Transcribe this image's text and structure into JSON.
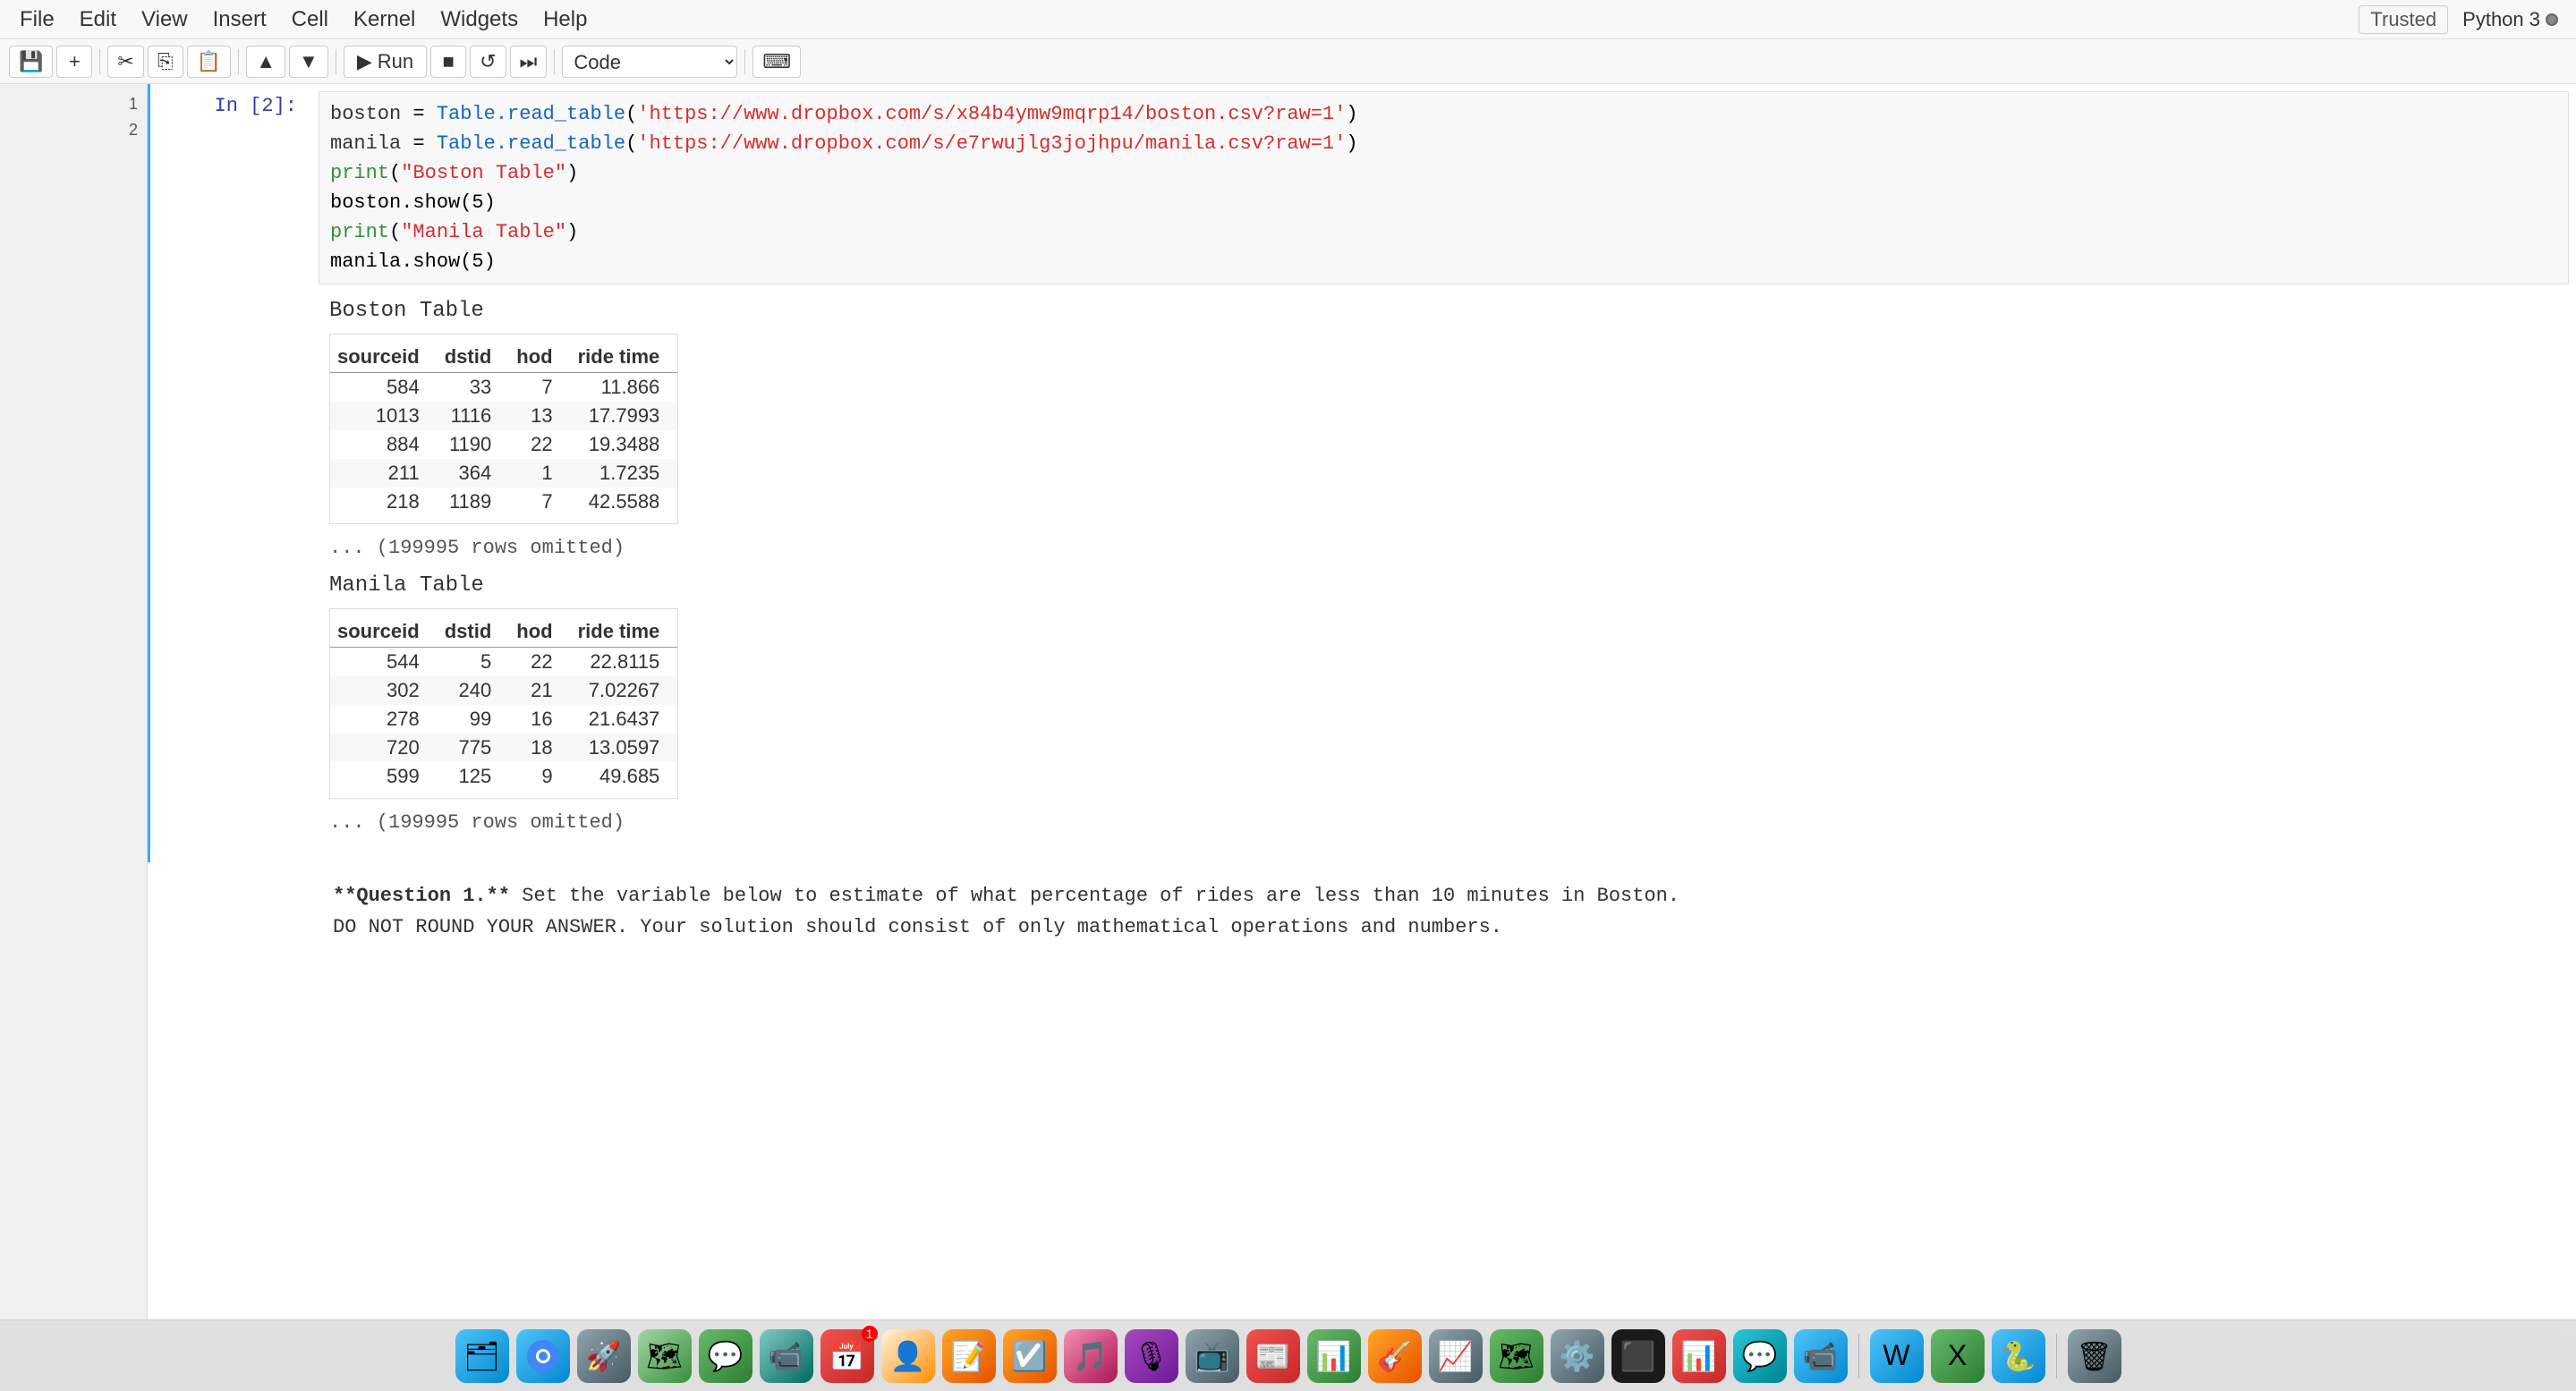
{
  "menubar": {
    "items": [
      "File",
      "Edit",
      "View",
      "Insert",
      "Cell",
      "Kernel",
      "Widgets",
      "Help"
    ],
    "trusted": "Trusted",
    "kernel_name": "Python 3"
  },
  "toolbar": {
    "save_label": "💾",
    "add_label": "+",
    "cut_label": "✂",
    "copy_label": "⎘",
    "paste_label": "📋",
    "move_up_label": "▲",
    "move_down_label": "▼",
    "run_label": "Run",
    "stop_label": "■",
    "restart_label": "↺",
    "skip_label": "⏭",
    "cell_type": "Code",
    "keyboard_label": "⌨"
  },
  "cell": {
    "prompt": "In [2]:",
    "code_lines": [
      "boston = Table.read_table('https://www.dropbox.com/s/x84b4ymw9mqrp14/boston.csv?raw=1')",
      "manila = Table.read_table('https://www.dropbox.com/s/e7rwujlg3jojhpu/manila.csv?raw=1')",
      "print(\"Boston Table\")",
      "boston.show(5)",
      "print(\"Manila Table\")",
      "manila.show(5)"
    ]
  },
  "output": {
    "boston_title": "Boston Table",
    "boston_table": {
      "headers": [
        "sourceid",
        "dstid",
        "hod",
        "ride time"
      ],
      "rows": [
        [
          "584",
          "33",
          "7",
          "11.866"
        ],
        [
          "1013",
          "1116",
          "13",
          "17.7993"
        ],
        [
          "884",
          "1190",
          "22",
          "19.3488"
        ],
        [
          "211",
          "364",
          "1",
          "1.7235"
        ],
        [
          "218",
          "1189",
          "7",
          "42.5588"
        ]
      ]
    },
    "boston_omitted": "... (199995 rows omitted)",
    "manila_title": "Manila Table",
    "manila_table": {
      "headers": [
        "sourceid",
        "dstid",
        "hod",
        "ride time"
      ],
      "rows": [
        [
          "544",
          "5",
          "22",
          "22.8115"
        ],
        [
          "302",
          "240",
          "21",
          "7.02267"
        ],
        [
          "278",
          "99",
          "16",
          "21.6437"
        ],
        [
          "720",
          "775",
          "18",
          "13.0597"
        ],
        [
          "599",
          "125",
          "9",
          "49.685"
        ]
      ]
    },
    "manila_omitted": "... (199995 rows omitted)"
  },
  "question": {
    "text_bold": "**Question 1.**",
    "text": " Set the variable below to estimate of what percentage of rides are less than 10 minutes in Boston.",
    "text2": "DO NOT ROUND YOUR ANSWER. Your solution should consist of only mathematical operations and numbers."
  },
  "dock": {
    "items": [
      {
        "name": "finder",
        "emoji": "🗂",
        "color": "blue"
      },
      {
        "name": "chrome",
        "emoji": "⬤",
        "color": "blue"
      },
      {
        "name": "launch-pad",
        "emoji": "🚀",
        "color": "gray"
      },
      {
        "name": "maps",
        "emoji": "🗺",
        "color": "green"
      },
      {
        "name": "messages",
        "emoji": "💬",
        "color": "green"
      },
      {
        "name": "facetime",
        "emoji": "📹",
        "color": "green"
      },
      {
        "name": "calendar",
        "emoji": "📅",
        "color": "red",
        "badge": "1"
      },
      {
        "name": "contacts",
        "emoji": "👤",
        "color": "gray"
      },
      {
        "name": "notes",
        "emoji": "📝",
        "color": "orange"
      },
      {
        "name": "reminders",
        "emoji": "⏰",
        "color": "orange"
      },
      {
        "name": "itunes",
        "emoji": "🎵",
        "color": "purple"
      },
      {
        "name": "podcasts",
        "emoji": "🎙",
        "color": "purple"
      },
      {
        "name": "appletv",
        "emoji": "📺",
        "color": "gray"
      },
      {
        "name": "news",
        "emoji": "📰",
        "color": "red"
      },
      {
        "name": "numbers",
        "emoji": "📊",
        "color": "green"
      },
      {
        "name": "garageband",
        "emoji": "🎸",
        "color": "orange"
      },
      {
        "name": "stocks",
        "emoji": "📈",
        "color": "gray"
      },
      {
        "name": "maps2",
        "emoji": "🗺",
        "color": "green"
      },
      {
        "name": "system-prefs",
        "emoji": "⚙️",
        "color": "gray"
      },
      {
        "name": "terminal",
        "emoji": "⬛",
        "color": "gray"
      },
      {
        "name": "powerpoint",
        "emoji": "📊",
        "color": "red"
      },
      {
        "name": "slack",
        "emoji": "💬",
        "color": "teal"
      },
      {
        "name": "zoom",
        "emoji": "📹",
        "color": "blue"
      },
      {
        "name": "word",
        "emoji": "📝",
        "color": "blue"
      },
      {
        "name": "excel",
        "emoji": "📊",
        "color": "green"
      },
      {
        "name": "python",
        "emoji": "🐍",
        "color": "blue"
      },
      {
        "name": "trash",
        "emoji": "🗑",
        "color": "gray"
      }
    ]
  }
}
